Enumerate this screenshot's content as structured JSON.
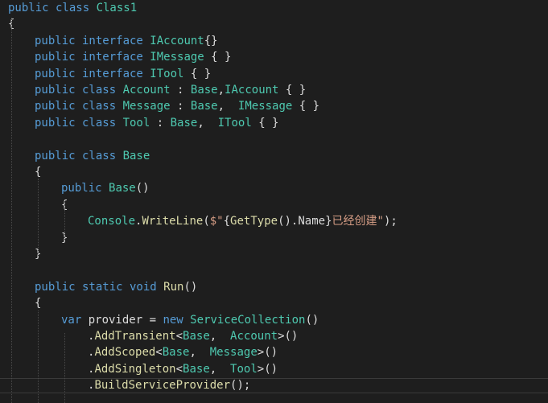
{
  "code": {
    "lines": [
      [
        {
          "t": "public class ",
          "c": "kw"
        },
        {
          "t": "Class1",
          "c": "ty"
        }
      ],
      [
        {
          "t": "{",
          "c": "pl"
        }
      ],
      [
        {
          "t": "public interface ",
          "c": "kw"
        },
        {
          "t": "IAccount",
          "c": "ty"
        },
        {
          "t": "{}",
          "c": "pl"
        }
      ],
      [
        {
          "t": "public interface ",
          "c": "kw"
        },
        {
          "t": "IMessage",
          "c": "ty"
        },
        {
          "t": " { }",
          "c": "pl"
        }
      ],
      [
        {
          "t": "public interface ",
          "c": "kw"
        },
        {
          "t": "ITool",
          "c": "ty"
        },
        {
          "t": " { }",
          "c": "pl"
        }
      ],
      [
        {
          "t": "public class ",
          "c": "kw"
        },
        {
          "t": "Account",
          "c": "ty"
        },
        {
          "t": " : ",
          "c": "pl"
        },
        {
          "t": "Base",
          "c": "ty"
        },
        {
          "t": ",",
          "c": "pl"
        },
        {
          "t": "IAccount",
          "c": "ty"
        },
        {
          "t": " { }",
          "c": "pl"
        }
      ],
      [
        {
          "t": "public class ",
          "c": "kw"
        },
        {
          "t": "Message",
          "c": "ty"
        },
        {
          "t": " : ",
          "c": "pl"
        },
        {
          "t": "Base",
          "c": "ty"
        },
        {
          "t": ",  ",
          "c": "pl"
        },
        {
          "t": "IMessage",
          "c": "ty"
        },
        {
          "t": " { }",
          "c": "pl"
        }
      ],
      [
        {
          "t": "public class ",
          "c": "kw"
        },
        {
          "t": "Tool",
          "c": "ty"
        },
        {
          "t": " : ",
          "c": "pl"
        },
        {
          "t": "Base",
          "c": "ty"
        },
        {
          "t": ",  ",
          "c": "pl"
        },
        {
          "t": "ITool",
          "c": "ty"
        },
        {
          "t": " { }",
          "c": "pl"
        }
      ],
      [],
      [
        {
          "t": "public class ",
          "c": "kw"
        },
        {
          "t": "Base",
          "c": "ty"
        }
      ],
      [
        {
          "t": "{",
          "c": "pl"
        }
      ],
      [
        {
          "t": "public ",
          "c": "kw"
        },
        {
          "t": "Base",
          "c": "ty"
        },
        {
          "t": "()",
          "c": "pl"
        }
      ],
      [
        {
          "t": "{",
          "c": "pl"
        }
      ],
      [
        {
          "t": "Console",
          "c": "ty"
        },
        {
          "t": ".",
          "c": "pl"
        },
        {
          "t": "WriteLine",
          "c": "mt"
        },
        {
          "t": "(",
          "c": "pl"
        },
        {
          "t": "$\"",
          "c": "st"
        },
        {
          "t": "{",
          "c": "pl"
        },
        {
          "t": "GetType",
          "c": "mt"
        },
        {
          "t": "().Name}",
          "c": "pl"
        },
        {
          "t": "已经创建\"",
          "c": "st"
        },
        {
          "t": ");",
          "c": "pl"
        }
      ],
      [
        {
          "t": "}",
          "c": "pl"
        }
      ],
      [
        {
          "t": "}",
          "c": "pl"
        }
      ],
      [],
      [
        {
          "t": "public static void ",
          "c": "kw"
        },
        {
          "t": "Run",
          "c": "mt"
        },
        {
          "t": "()",
          "c": "pl"
        }
      ],
      [
        {
          "t": "{",
          "c": "pl"
        }
      ],
      [
        {
          "t": "var ",
          "c": "kw"
        },
        {
          "t": "provider",
          "c": "pl"
        },
        {
          "t": " = ",
          "c": "pl"
        },
        {
          "t": "new ",
          "c": "kw"
        },
        {
          "t": "ServiceCollection",
          "c": "ty"
        },
        {
          "t": "()",
          "c": "pl"
        }
      ],
      [
        {
          "t": ".",
          "c": "pl"
        },
        {
          "t": "AddTransient",
          "c": "mt"
        },
        {
          "t": "<",
          "c": "pl"
        },
        {
          "t": "Base",
          "c": "ty"
        },
        {
          "t": ",  ",
          "c": "pl"
        },
        {
          "t": "Account",
          "c": "ty"
        },
        {
          "t": ">()",
          "c": "pl"
        }
      ],
      [
        {
          "t": ".",
          "c": "pl"
        },
        {
          "t": "AddScoped",
          "c": "mt"
        },
        {
          "t": "<",
          "c": "pl"
        },
        {
          "t": "Base",
          "c": "ty"
        },
        {
          "t": ",  ",
          "c": "pl"
        },
        {
          "t": "Message",
          "c": "ty"
        },
        {
          "t": ">()",
          "c": "pl"
        }
      ],
      [
        {
          "t": ".",
          "c": "pl"
        },
        {
          "t": "AddSingleton",
          "c": "mt"
        },
        {
          "t": "<",
          "c": "pl"
        },
        {
          "t": "Base",
          "c": "ty"
        },
        {
          "t": ",  ",
          "c": "pl"
        },
        {
          "t": "Tool",
          "c": "ty"
        },
        {
          "t": ">()",
          "c": "pl"
        }
      ],
      [
        {
          "t": ".",
          "c": "pl"
        },
        {
          "t": "BuildServiceProvider",
          "c": "mt"
        },
        {
          "t": "();",
          "c": "pl"
        }
      ]
    ]
  }
}
